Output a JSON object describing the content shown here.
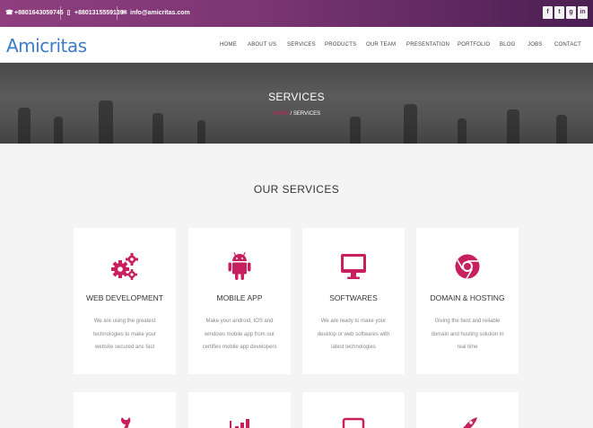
{
  "topbar": {
    "phone1": "+8801643059745",
    "phone2": "+8801315559139",
    "email": "info@amicritas.com",
    "social": [
      "f",
      "t",
      "g",
      "in"
    ]
  },
  "brand": "Amicritas",
  "nav": [
    "HOME",
    "ABOUT US",
    "SERVICES",
    "PRODUCTS",
    "OUR TEAM",
    "PRESENTATION",
    "PORTFOLIO",
    "BLOG",
    "JOBS",
    "CONTACT"
  ],
  "hero": {
    "title": "SERVICES",
    "breadcrumb_home": "HOME",
    "breadcrumb_sep": "/",
    "breadcrumb_current": "SERVICES"
  },
  "section_title": "OUR SERVICES",
  "services": [
    {
      "title": "WEB DEVELOPMENT",
      "desc": "We are using the greatest technologies to make your website secured ans fast",
      "icon": "gears-icon"
    },
    {
      "title": "MOBILE APP",
      "desc": "Make your android, IOS and windows mobile app from our certifies mobile app developers",
      "icon": "android-icon"
    },
    {
      "title": "SOFTWARES",
      "desc": "We are ready to make your desktop or web softwares with latest technologies",
      "icon": "desktop-icon"
    },
    {
      "title": "DOMAIN & HOSTING",
      "desc": "Giving the best and reliable domain and hosting solution in real time",
      "icon": "chrome-icon"
    }
  ],
  "services_row2_icons": [
    "wrench-icon",
    "bar-chart-icon",
    "monitor-icon",
    "rocket-icon"
  ],
  "colors": {
    "accent": "#c8205e",
    "brand": "#3e7bc6",
    "topbar": "#7a3573"
  }
}
